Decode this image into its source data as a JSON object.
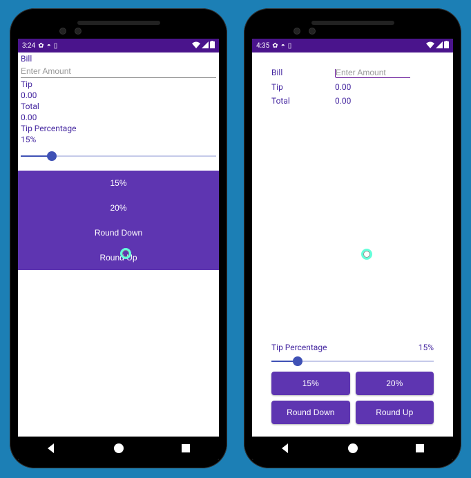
{
  "left": {
    "status": {
      "time": "3:24"
    },
    "bill_label": "Bill",
    "amount_placeholder": "Enter Amount",
    "tip_label": "Tip",
    "tip_value": "0.00",
    "total_label": "Total",
    "total_value": "0.00",
    "tip_percentage_label": "Tip Percentage",
    "tip_percentage_value": "15%",
    "slider_fill_pct": 16,
    "buttons": {
      "p15": "15%",
      "p20": "20%",
      "round_down": "Round Down",
      "round_up": "Round Up"
    }
  },
  "right": {
    "status": {
      "time": "4:35"
    },
    "bill_label": "Bill",
    "amount_placeholder": "Enter Amount",
    "tip_label": "Tip",
    "tip_value": "0.00",
    "total_label": "Total",
    "total_value": "0.00",
    "tip_percentage_label": "Tip Percentage",
    "tip_percentage_value": "15%",
    "slider_fill_pct": 16,
    "buttons": {
      "p15": "15%",
      "p20": "20%",
      "round_down": "Round Down",
      "round_up": "Round Up"
    }
  }
}
